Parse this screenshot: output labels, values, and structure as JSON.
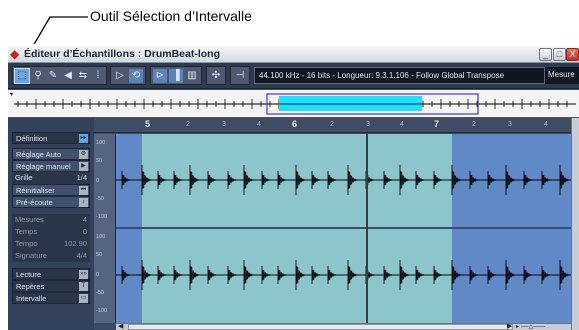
{
  "callout": {
    "text": "Outil Sélection d’Intervalle"
  },
  "window": {
    "title": "Éditeur d’Échantillons : DrumBeat-long",
    "buttons": {
      "minimize": "_",
      "maximize": "□",
      "close": "X"
    }
  },
  "toolbar": {
    "info": "44.100 kHz - 16 bits - Longueur: 9.3.1.106 - Follow Global Transpose",
    "mesure_label": "Mesure",
    "tools": [
      {
        "icon": "range-select-icon",
        "glyph": "⬚",
        "selected": true
      },
      {
        "icon": "zoom-icon",
        "glyph": "⚲"
      },
      {
        "icon": "pencil-icon",
        "glyph": "✎"
      },
      {
        "icon": "speaker-icon",
        "glyph": "◀"
      },
      {
        "icon": "scrub-icon",
        "glyph": "⇆"
      },
      {
        "icon": "hitpoint-icon",
        "glyph": "⁞"
      }
    ],
    "transport": [
      {
        "icon": "play-icon",
        "glyph": "▷"
      },
      {
        "icon": "loop-icon",
        "glyph": "⟲",
        "active": true
      }
    ],
    "snap": [
      {
        "icon": "snap-start-icon",
        "glyph": "⊳",
        "active": true
      },
      {
        "icon": "snap-zero-icon",
        "glyph": "▐",
        "active": true
      },
      {
        "icon": "snap-grid-icon",
        "glyph": "▥"
      }
    ],
    "extra": [
      {
        "icon": "autoscroll-icon",
        "glyph": "✣"
      },
      {
        "icon": "crossing-icon",
        "glyph": "⊣"
      }
    ]
  },
  "ruler": {
    "bars": [
      {
        "label": "5",
        "major": true
      },
      {
        "label": "2"
      },
      {
        "label": "3"
      },
      {
        "label": "4"
      },
      {
        "label": "6",
        "major": true
      },
      {
        "label": "2"
      },
      {
        "label": "3"
      },
      {
        "label": "4"
      },
      {
        "label": "7",
        "major": true
      },
      {
        "label": "2"
      },
      {
        "label": "3"
      },
      {
        "label": "4"
      }
    ]
  },
  "vertical_ruler": {
    "top": [
      "100",
      "50",
      "0",
      "-50",
      "-100"
    ],
    "bottom": [
      "100",
      "50",
      "0",
      "-50",
      "-100"
    ]
  },
  "left_panel": {
    "sections": [
      {
        "label": "Définition",
        "type": "head",
        "icon": "warp-icon",
        "icon_text": "▸▸"
      },
      {
        "label": "Réglage Auto",
        "type": "btn",
        "icon": "auto-adjust-icon",
        "icon_text": "⚙"
      },
      {
        "label": "Réglage manuel",
        "type": "btn",
        "icon": "manual-adjust-icon",
        "icon_text": "▶"
      },
      {
        "label": "Grille",
        "type": "field",
        "value": "1/4"
      },
      {
        "label": "Réinitialiser",
        "type": "btn",
        "icon": "reset-icon",
        "icon_text": "⏮"
      },
      {
        "label": "Pré-écoute",
        "type": "btn",
        "icon": "preview-icon",
        "icon_text": "♪"
      },
      {
        "label": "Mesures",
        "type": "dim",
        "value": "4"
      },
      {
        "label": "Temps",
        "type": "dim",
        "value": "0"
      },
      {
        "label": "Tempo",
        "type": "dim",
        "value": "102.90"
      },
      {
        "label": "Signature",
        "type": "dim",
        "value": "4/4"
      },
      {
        "label": "Lecture",
        "type": "head",
        "icon": "playback-icon",
        "icon_text": "»»"
      },
      {
        "label": "Repères",
        "type": "head",
        "icon": "marker-icon",
        "icon_text": "T"
      },
      {
        "label": "Intervalle",
        "type": "head",
        "icon": "range-icon",
        "icon_text": "▭"
      }
    ]
  },
  "colors": {
    "selection": "#8cc6cb",
    "waveform_bg": "#5f89c7",
    "overview_range": "#1fe0ff",
    "waveform": "#0a0a0a"
  }
}
